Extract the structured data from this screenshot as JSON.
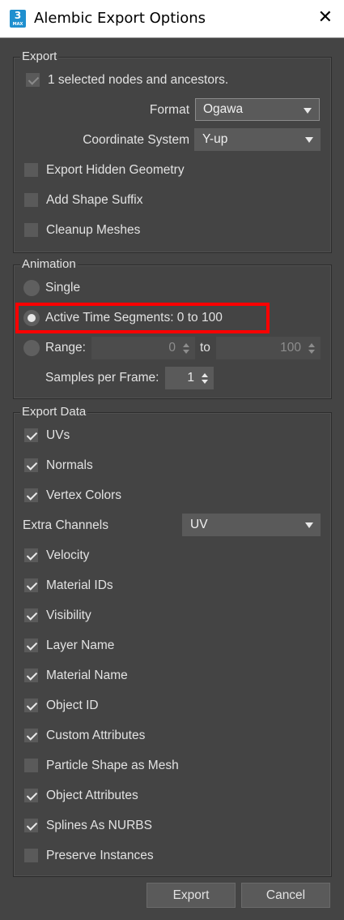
{
  "window": {
    "title": "Alembic Export Options",
    "icon_number": "3",
    "icon_sub": "MAX",
    "close_glyph": "✕"
  },
  "export": {
    "legend": "Export",
    "selected_nodes": {
      "label": "1 selected nodes and ancestors.",
      "checked": true,
      "disabled": true
    },
    "format": {
      "label": "Format",
      "value": "Ogawa"
    },
    "coordinate_system": {
      "label": "Coordinate System",
      "value": "Y-up"
    },
    "options": [
      {
        "label": "Export Hidden Geometry",
        "checked": false
      },
      {
        "label": "Add Shape Suffix",
        "checked": false
      },
      {
        "label": "Cleanup Meshes",
        "checked": false
      }
    ]
  },
  "animation": {
    "legend": "Animation",
    "single_label": "Single",
    "active_label": "Active Time Segments: 0 to 100",
    "range_label": "Range:",
    "range_from": "0",
    "range_to_label": "to",
    "range_to": "100",
    "samples_label": "Samples per Frame:",
    "samples_value": "1",
    "selected": "active"
  },
  "export_data": {
    "legend": "Export Data",
    "items_top": [
      {
        "label": "UVs",
        "checked": true
      },
      {
        "label": "Normals",
        "checked": true
      },
      {
        "label": "Vertex Colors",
        "checked": true
      }
    ],
    "extra_channels": {
      "label": "Extra Channels",
      "value": "UV"
    },
    "items_bottom": [
      {
        "label": "Velocity",
        "checked": true
      },
      {
        "label": "Material IDs",
        "checked": true
      },
      {
        "label": "Visibility",
        "checked": true
      },
      {
        "label": "Layer Name",
        "checked": true
      },
      {
        "label": "Material Name",
        "checked": true
      },
      {
        "label": "Object ID",
        "checked": true
      },
      {
        "label": "Custom Attributes",
        "checked": true
      },
      {
        "label": "Particle Shape as Mesh",
        "checked": false
      },
      {
        "label": "Object Attributes",
        "checked": true
      },
      {
        "label": "Splines As NURBS",
        "checked": true
      },
      {
        "label": "Preserve Instances",
        "checked": false
      }
    ]
  },
  "buttons": {
    "export": "Export",
    "cancel": "Cancel"
  }
}
